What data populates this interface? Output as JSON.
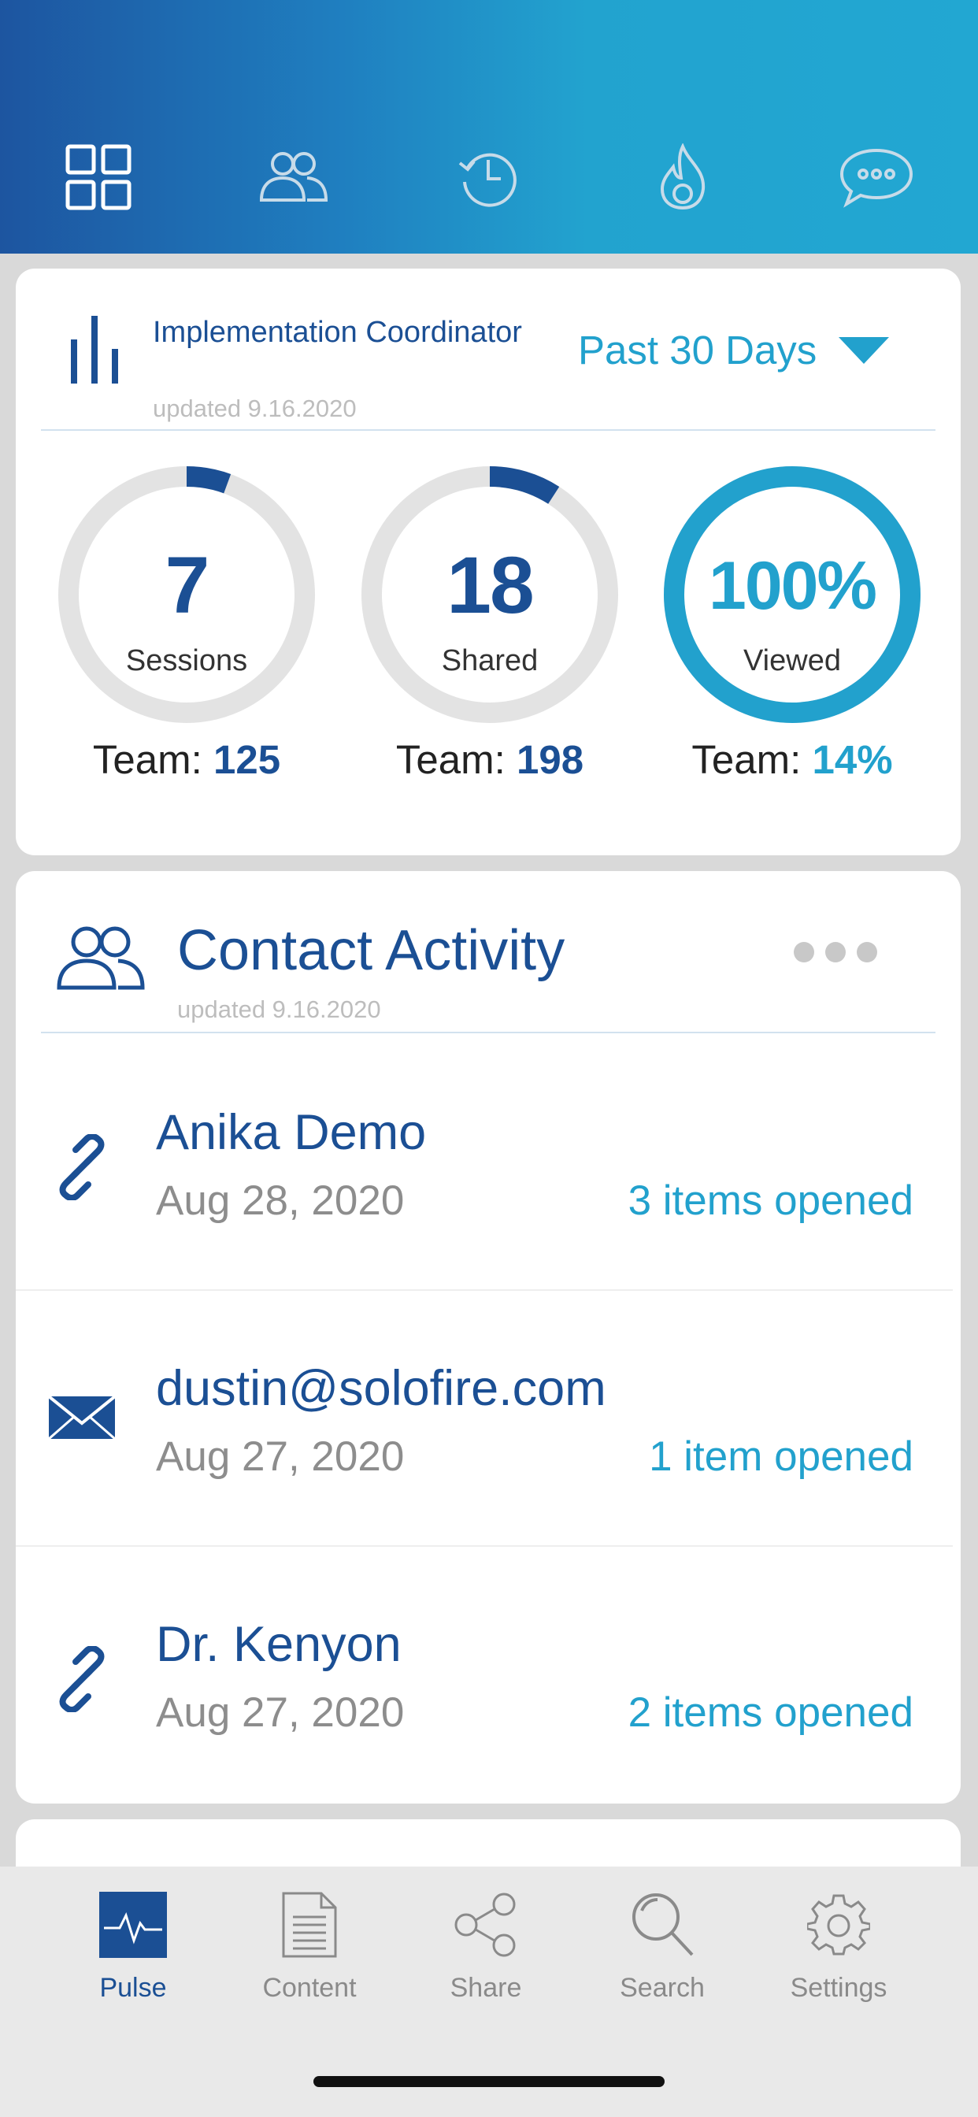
{
  "header": {
    "tabs": [
      {
        "icon": "dashboard-grid-icon"
      },
      {
        "icon": "contacts-icon"
      },
      {
        "icon": "history-icon"
      },
      {
        "icon": "fire-icon"
      },
      {
        "icon": "chat-bubble-icon"
      }
    ]
  },
  "stats": {
    "title": "Implementation Coordinator",
    "updated": "updated 9.16.2020",
    "range": "Past 30 Days",
    "metrics": [
      {
        "value": "7",
        "label": "Sessions",
        "team_label": "Team:",
        "team_value": "125",
        "progress": 0.056
      },
      {
        "value": "18",
        "label": "Shared",
        "team_label": "Team:",
        "team_value": "198",
        "progress": 0.091
      },
      {
        "value": "100%",
        "label": "Viewed",
        "team_label": "Team:",
        "team_value": "14%",
        "progress": 1.0
      }
    ]
  },
  "activity": {
    "title": "Contact Activity",
    "updated": "updated 9.16.2020",
    "items": [
      {
        "icon": "link-icon",
        "name": "Anika Demo",
        "date": "Aug 28, 2020",
        "opened": "3 items opened"
      },
      {
        "icon": "envelope-icon",
        "name": "dustin@solofire.com",
        "date": "Aug 27, 2020",
        "opened": "1 item opened"
      },
      {
        "icon": "link-icon",
        "name": "Dr. Kenyon",
        "date": "Aug 27, 2020",
        "opened": "2 items opened"
      }
    ]
  },
  "tabbar": {
    "tabs": [
      {
        "label": "Pulse",
        "icon": "pulse-icon",
        "active": true
      },
      {
        "label": "Content",
        "icon": "document-icon"
      },
      {
        "label": "Share",
        "icon": "share-icon"
      },
      {
        "label": "Search",
        "icon": "search-icon"
      },
      {
        "label": "Settings",
        "icon": "gear-icon"
      }
    ]
  },
  "colors": {
    "brand_blue": "#1b4f94",
    "accent_cyan": "#22a1cd",
    "ring_track": "#e3e3e3"
  }
}
